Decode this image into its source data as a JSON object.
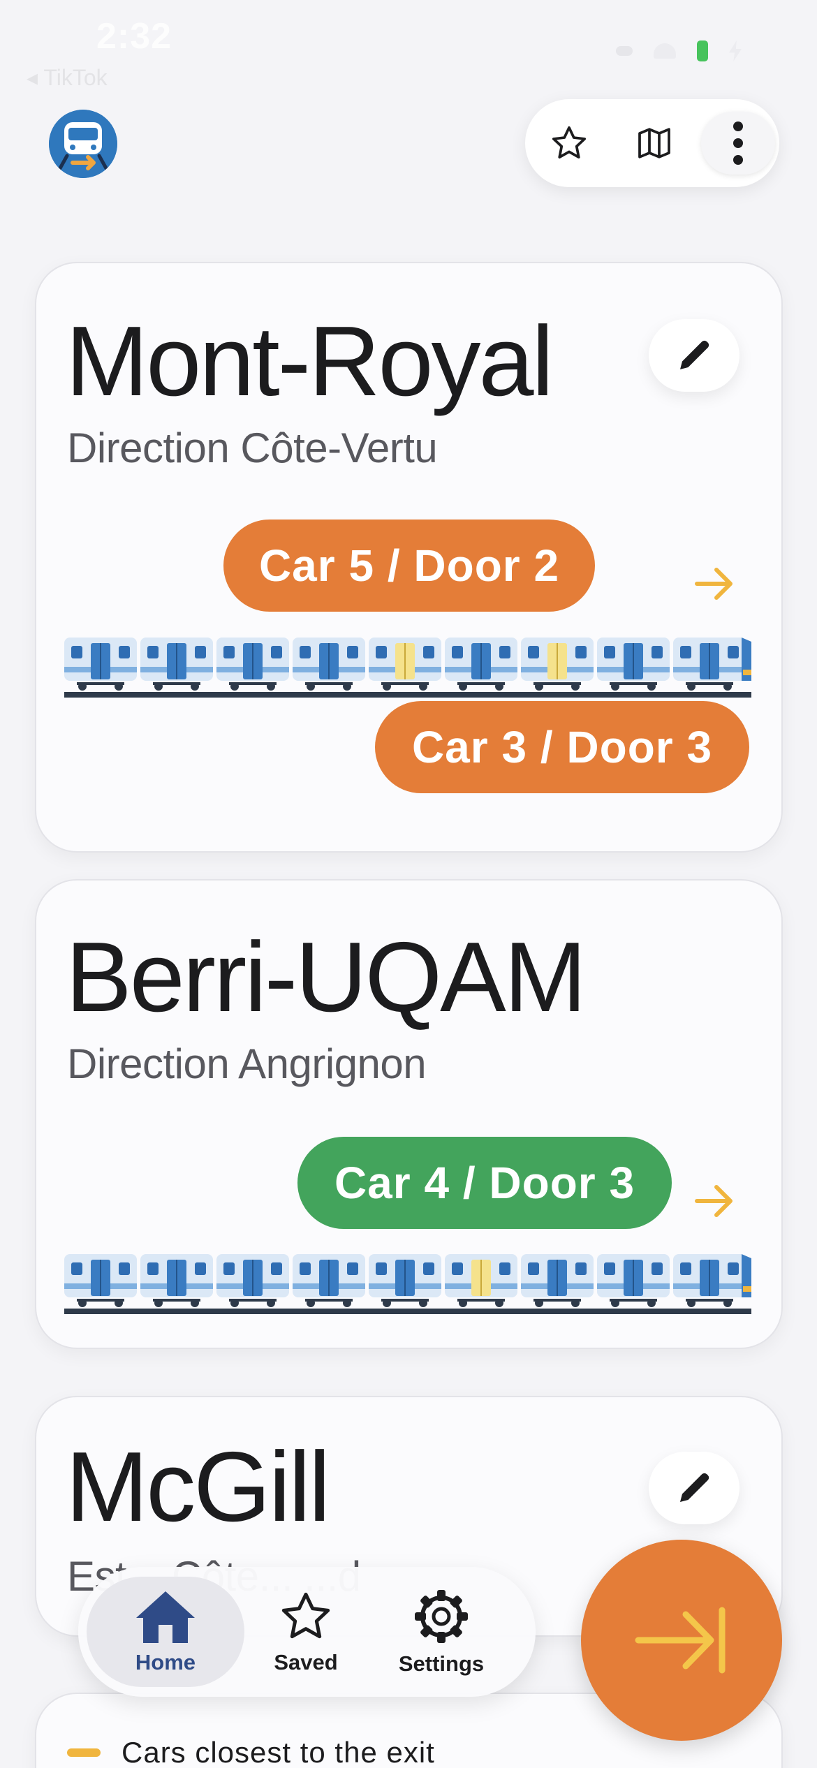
{
  "status_bar": {
    "time": "2:32",
    "back_app": "◂ TikTok"
  },
  "header": {
    "logo_icon": "metro-train-exit-icon",
    "toolbar": {
      "favorite_icon": "star-outline-icon",
      "map_icon": "map-icon",
      "more_icon": "more-vertical-icon"
    }
  },
  "cards": [
    {
      "station": "Mont-Royal",
      "direction": "Direction Côte-Vertu",
      "badges": [
        {
          "label": "Car 5 / Door 2",
          "color": "#e47d38",
          "car": 5,
          "door": 2
        },
        {
          "label": "Car 3 / Door 3",
          "color": "#e47d38",
          "car": 3,
          "door": 3
        }
      ],
      "highlighted_cars": [
        5,
        7
      ]
    },
    {
      "station": "Berri-UQAM",
      "direction": "Direction Angrignon",
      "badges": [
        {
          "label": "Car 4 / Door 3",
          "color": "#43a45c",
          "car": 4,
          "door": 3
        }
      ],
      "highlighted_cars": [
        6
      ]
    },
    {
      "station": "McGill",
      "direction": "Est... Côte... ...d"
    }
  ],
  "legend": {
    "label": "Cars closest to the exit",
    "color": "#f0b53e"
  },
  "bottom_nav": {
    "items": [
      {
        "label": "Home",
        "icon": "home-icon",
        "active": true
      },
      {
        "label": "Saved",
        "icon": "star-icon",
        "active": false
      },
      {
        "label": "Settings",
        "icon": "gear-icon",
        "active": false
      }
    ]
  },
  "fab": {
    "icon": "arrow-to-exit-icon",
    "color": "#e47d38"
  },
  "colors": {
    "accent": "#e47d38",
    "success": "#43a45c",
    "exit_marker": "#f0b53e",
    "train_blue": "#2f78bd",
    "nav_active": "#2f4b87"
  }
}
